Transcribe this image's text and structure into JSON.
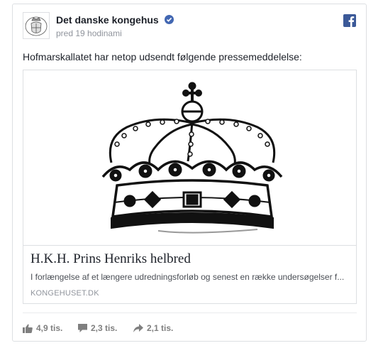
{
  "post": {
    "page_name": "Det danske kongehus",
    "timestamp": "pred 19 hodinami",
    "text": "Hofmarskallatet har netop udsendt følgende pressemeddelelse:",
    "verified": true
  },
  "link": {
    "title": "H.K.H. Prins Henriks helbred",
    "description": "I forlængelse af et længere udredningsforløb og senest en række undersøgelser f...",
    "domain": "KONGEHUSET.DK",
    "image": "crown-illustration"
  },
  "stats": {
    "likes": "4,9 tis.",
    "comments": "2,3 tis.",
    "shares": "2,1 tis."
  },
  "icons": {
    "brand": "facebook-icon",
    "verified": "verified-badge-icon",
    "like": "thumbs-up-icon",
    "comment": "comment-bubble-icon",
    "share": "share-arrow-icon"
  },
  "colors": {
    "facebook_blue": "#3b5998",
    "verified_blue": "#4267b2",
    "text_primary": "#1d2129",
    "text_secondary": "#90949c"
  }
}
